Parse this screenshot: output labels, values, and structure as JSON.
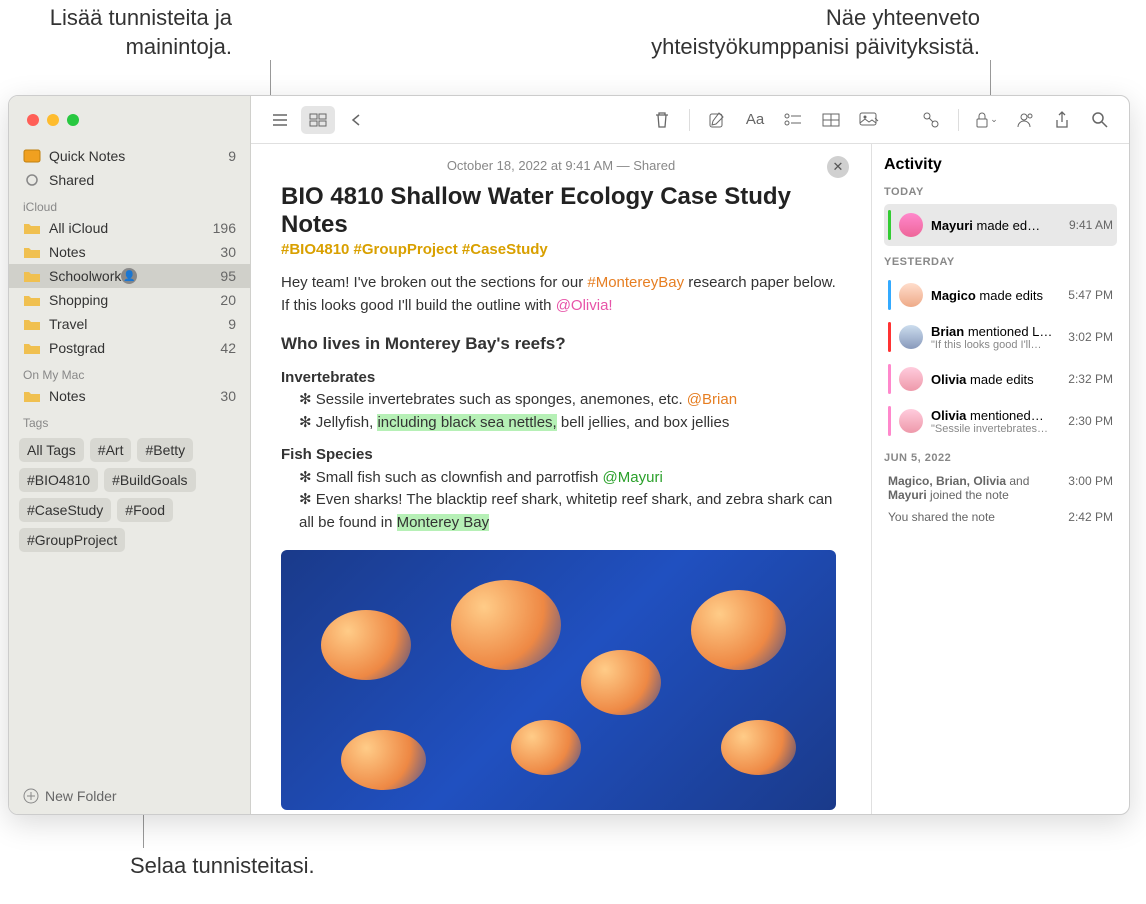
{
  "callouts": {
    "top_left_1": "Lisää tunnisteita ja",
    "top_left_2": "mainintoja.",
    "top_right_1": "Näe yhteenveto",
    "top_right_2": "yhteistyökumppanisi päivityksistä.",
    "bottom": "Selaa tunnisteitasi."
  },
  "sidebar": {
    "quick_notes": "Quick Notes",
    "quick_count": "9",
    "shared": "Shared",
    "icloud_header": "iCloud",
    "all_icloud": "All iCloud",
    "all_icloud_count": "196",
    "notes": "Notes",
    "notes_count": "30",
    "schoolwork": "Schoolwork",
    "schoolwork_count": "95",
    "shopping": "Shopping",
    "shopping_count": "20",
    "travel": "Travel",
    "travel_count": "9",
    "postgrad": "Postgrad",
    "postgrad_count": "42",
    "onmymac_header": "On My Mac",
    "om_notes": "Notes",
    "om_notes_count": "30",
    "tags_header": "Tags",
    "tags": {
      "0": "All Tags",
      "1": "#Art",
      "2": "#Betty",
      "3": "#BIO4810",
      "4": "#BuildGoals",
      "5": "#CaseStudy",
      "6": "#Food",
      "7": "#GroupProject"
    },
    "new_folder": "New Folder"
  },
  "note": {
    "date": "October 18, 2022 at 9:41 AM — Shared",
    "title": "BIO 4810 Shallow Water Ecology Case Study Notes",
    "tags_line": "#BIO4810 #GroupProject #CaseStudy",
    "intro_1": "Hey team! I've broken out the sections for our ",
    "hashtag1": "#MontereyBay",
    "intro_2": " research paper below. If this looks good I'll build the outline with ",
    "mention_olivia": "@Olivia!",
    "h2": "Who lives in Monterey Bay's reefs?",
    "sub1": "Invertebrates",
    "b1a": "Sessile invertebrates such as sponges, anemones, etc. ",
    "mention_brian": "@Brian",
    "b1b_pre": "Jellyfish, ",
    "b1b_hl": "including black sea nettles,",
    "b1b_post": " bell jellies, and box jellies",
    "sub2": "Fish Species",
    "b2a": "Small fish such as clownfish and parrotfish ",
    "mention_mayuri": "@Mayuri",
    "b2b_pre": "Even sharks! The blacktip reef shark, whitetip reef shark, and zebra shark can all be found in ",
    "b2b_hl": "Monterey Bay"
  },
  "activity": {
    "title": "Activity",
    "today": "TODAY",
    "yesterday": "YESTERDAY",
    "jun5": "JUN 5, 2022",
    "i1_who": "Mayuri",
    "i1_act": " made ed…",
    "i1_time": "9:41 AM",
    "i2_who": "Magico",
    "i2_act": " made edits",
    "i2_time": "5:47 PM",
    "i3_who": "Brian",
    "i3_act": " mentioned L…",
    "i3_sub": "\"If this looks good I'll…",
    "i3_time": "3:02 PM",
    "i4_who": "Olivia",
    "i4_act": " made edits",
    "i4_time": "2:32 PM",
    "i5_who": "Olivia",
    "i5_act": " mentioned…",
    "i5_sub": "\"Sessile invertebrates…",
    "i5_time": "2:30 PM",
    "j1_txt": "Magico, Brian, Olivia and Mayuri joined the note",
    "j1_time": "3:00 PM",
    "j2_txt": "You shared the note",
    "j2_time": "2:42 PM"
  }
}
